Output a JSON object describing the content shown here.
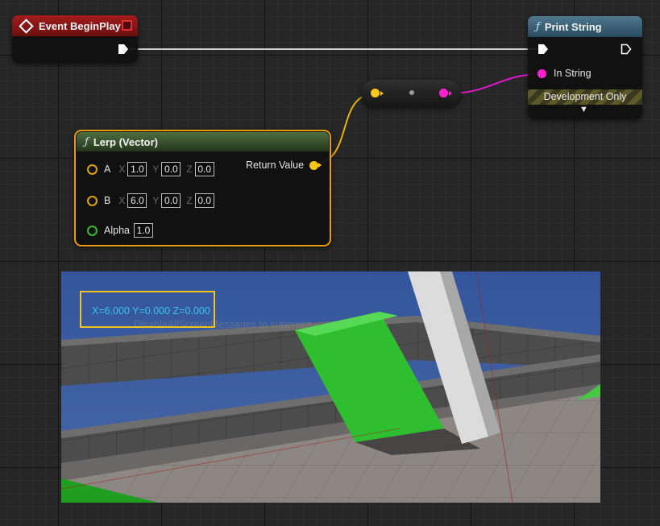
{
  "event_node": {
    "title": "Event BeginPlay"
  },
  "print_node": {
    "title": "Print String",
    "in_string_label": "In String",
    "dev_only_label": "Development Only"
  },
  "lerp_node": {
    "title": "Lerp (Vector)",
    "return_label": "Return Value",
    "a_label": "A",
    "b_label": "B",
    "alpha_label": "Alpha",
    "x_label": "X",
    "y_label": "Y",
    "z_label": "Z",
    "a": {
      "x": "1.0",
      "y": "0.0",
      "z": "0.0"
    },
    "b": {
      "x": "6.0",
      "y": "0.0",
      "z": "0.0"
    },
    "alpha": "1.0"
  },
  "viewport": {
    "message": "X=6.000 Y=0.000 Z=0.000",
    "ghost_text": "DisableAllScreenMessages to suppress"
  },
  "colors": {
    "exec": "#ffffff",
    "string_pin": "#ff20d0",
    "vector_pin": "#ffc717",
    "float_pin": "#3ab82e",
    "selection": "#e89a10"
  }
}
